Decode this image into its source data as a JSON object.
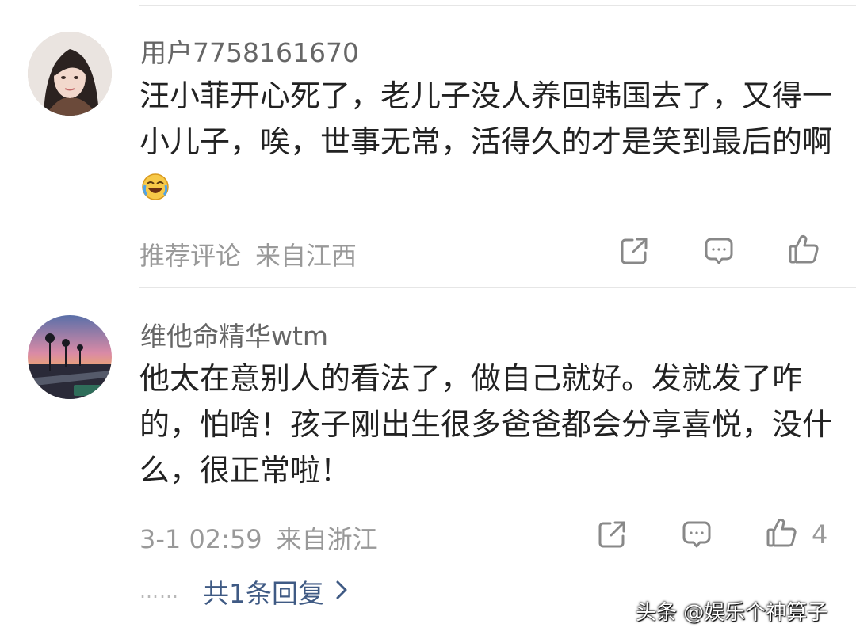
{
  "comments": [
    {
      "username": "用户7758161670",
      "text": "汪小菲开心死了，老儿子没人养回韩国去了，又得一小儿子，唉，世事无常，活得久的才是笑到最后的啊",
      "emoji": "laughing-crying-emoji",
      "meta_tag": "推荐评论",
      "location": "来自江西",
      "actions": [
        "share-icon",
        "comment-icon",
        "like-icon"
      ]
    },
    {
      "username": "维他命精华wtm",
      "text": "他太在意别人的看法了，做自己就好。发就发了咋的，怕啥！孩子刚出生很多爸爸都会分享喜悦，没什么，很正常啦！",
      "meta_tag": "3-1 02:59",
      "location": "来自浙江",
      "actions": [
        "share-icon",
        "comment-icon",
        "like-icon"
      ],
      "like_count": "4",
      "reply_dots": "……",
      "reply_link": "共1条回复"
    }
  ],
  "watermark": "头条 @娱乐个神算子",
  "colors": {
    "link": "#3f5a84",
    "meta": "#999999",
    "text": "#222222"
  }
}
